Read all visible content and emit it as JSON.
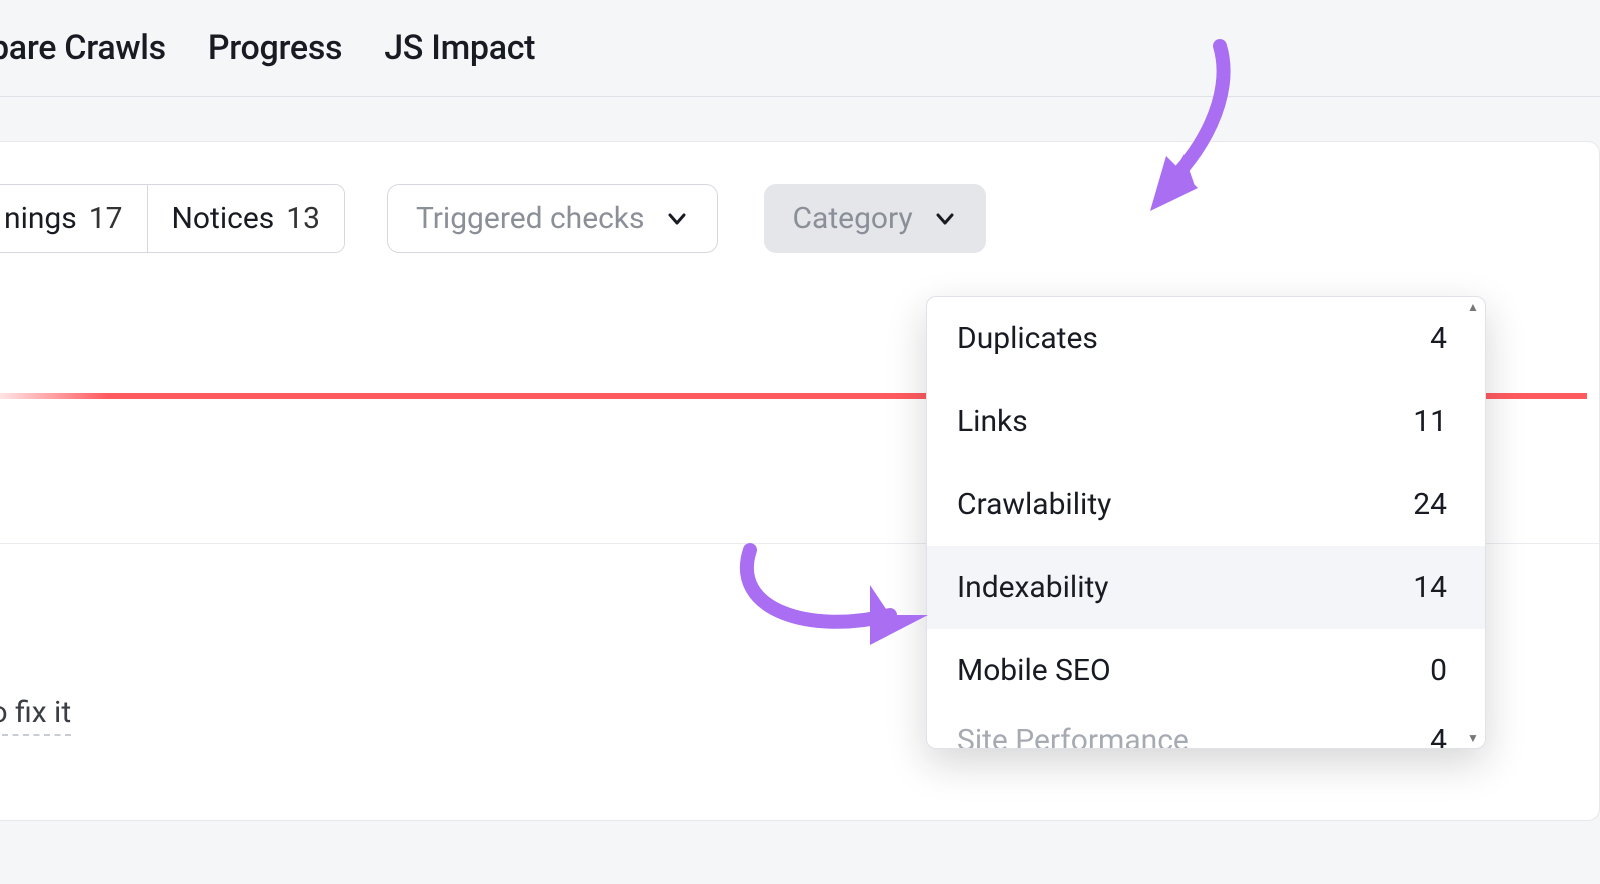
{
  "topnav": {
    "tabs": [
      "pare Crawls",
      "Progress",
      "JS Impact"
    ]
  },
  "filters": {
    "segments": [
      {
        "label": "nings",
        "count": 17
      },
      {
        "label": "Notices",
        "count": 13
      }
    ],
    "triggered_label": "Triggered checks",
    "category_label": "Category"
  },
  "truncated_1": "it",
  "truncated_2": " to fix it",
  "category_dropdown": {
    "items": [
      {
        "label": "Duplicates",
        "count": 4
      },
      {
        "label": "Links",
        "count": 11
      },
      {
        "label": "Crawlability",
        "count": 24
      },
      {
        "label": "Indexability",
        "count": 14,
        "highlight": true
      },
      {
        "label": "Mobile SEO",
        "count": 0
      }
    ],
    "peek": {
      "label": "Site Performance",
      "count": 4
    }
  },
  "annotation": {
    "color": "#a96ef2"
  }
}
